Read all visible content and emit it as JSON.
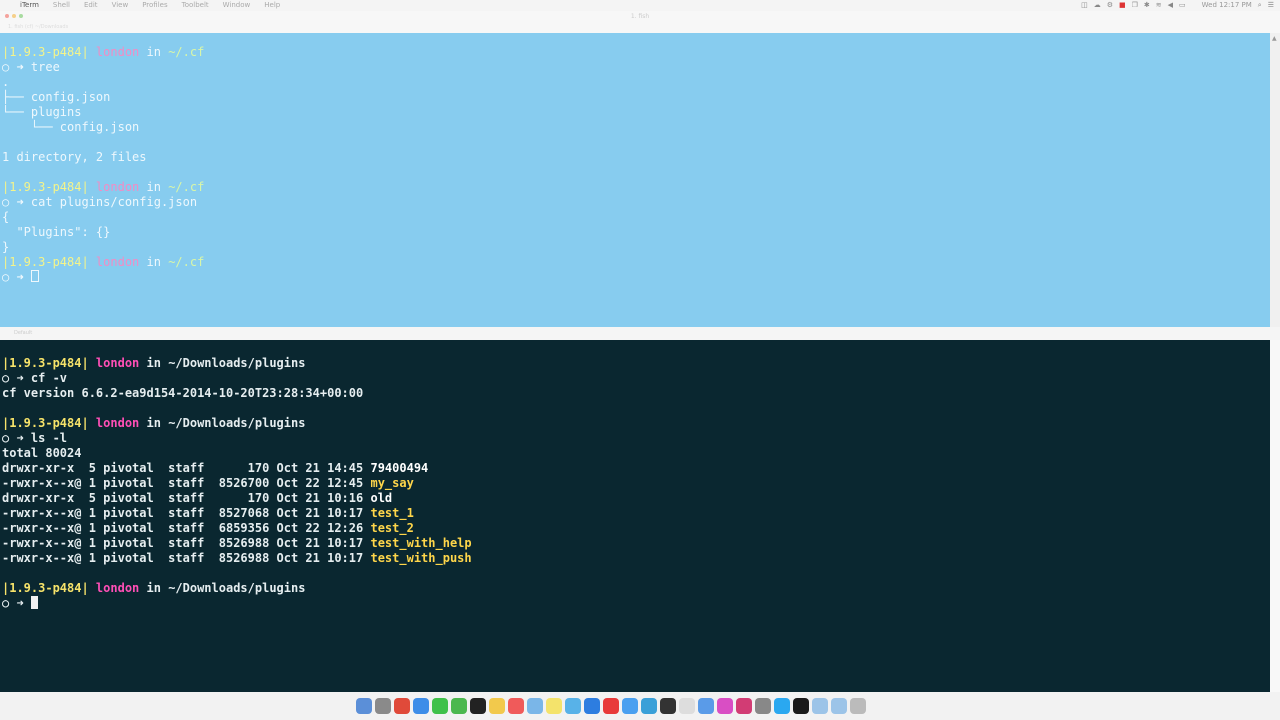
{
  "menubar": {
    "app_name": "iTerm",
    "items": [
      "Shell",
      "Edit",
      "View",
      "Profiles",
      "Toolbelt",
      "Window",
      "Help"
    ],
    "clock": "Wed 12:17 PM"
  },
  "window": {
    "title": "1. fish",
    "tab_label": "1. fish (cf)  ~/Downloads"
  },
  "split_label": "Default",
  "top_pane": {
    "lines": [
      [
        {
          "t": "|1.9.3-p484| ",
          "c": "c-yel"
        },
        {
          "t": "london",
          "c": "c-pink"
        },
        {
          "t": " in ",
          "c": "c-dim"
        },
        {
          "t": "~/.cf",
          "c": "c-green"
        }
      ],
      [
        {
          "t": "○ ➜ tree",
          "c": "c-dim"
        }
      ],
      [
        {
          "t": ".",
          "c": "c-dim"
        }
      ],
      [
        {
          "t": "├── config.json",
          "c": "c-dim"
        }
      ],
      [
        {
          "t": "└── plugins",
          "c": "c-dim"
        }
      ],
      [
        {
          "t": "    └── config.json",
          "c": "c-dim"
        }
      ],
      [
        {
          "t": "",
          "c": "c-dim"
        }
      ],
      [
        {
          "t": "1 directory, 2 files",
          "c": "c-dim"
        }
      ],
      [
        {
          "t": "",
          "c": "c-dim"
        }
      ],
      [
        {
          "t": "|1.9.3-p484| ",
          "c": "c-yel"
        },
        {
          "t": "london",
          "c": "c-pink"
        },
        {
          "t": " in ",
          "c": "c-dim"
        },
        {
          "t": "~/.cf",
          "c": "c-green"
        }
      ],
      [
        {
          "t": "○ ➜ cat plugins/config.json",
          "c": "c-dim"
        }
      ],
      [
        {
          "t": "{",
          "c": "c-dim"
        }
      ],
      [
        {
          "t": "  \"Plugins\": {}",
          "c": "c-dim"
        }
      ],
      [
        {
          "t": "}",
          "c": "c-dim"
        }
      ],
      [
        {
          "t": "|1.9.3-p484| ",
          "c": "c-yel"
        },
        {
          "t": "london",
          "c": "c-pink"
        },
        {
          "t": " in ",
          "c": "c-dim"
        },
        {
          "t": "~/.cf",
          "c": "c-green"
        }
      ],
      [
        {
          "t": "○ ➜ ",
          "c": "c-dim"
        }
      ]
    ]
  },
  "bottom_pane": {
    "lines": [
      [
        {
          "t": "|1.9.3-p484| ",
          "c": "c-yel"
        },
        {
          "t": "london",
          "c": "c-pink"
        },
        {
          "t": " in ",
          "c": "c-text"
        },
        {
          "t": "~/Downloads/plugins",
          "c": "c-text"
        }
      ],
      [
        {
          "t": "○ ➜ cf -v",
          "c": "c-text"
        }
      ],
      [
        {
          "t": "cf version 6.6.2-ea9d154-2014-10-20T23:28:34+00:00",
          "c": "c-text"
        }
      ],
      [
        {
          "t": "",
          "c": "c-text"
        }
      ],
      [
        {
          "t": "|1.9.3-p484| ",
          "c": "c-yel"
        },
        {
          "t": "london",
          "c": "c-pink"
        },
        {
          "t": " in ",
          "c": "c-text"
        },
        {
          "t": "~/Downloads/plugins",
          "c": "c-text"
        }
      ],
      [
        {
          "t": "○ ➜ ls -l",
          "c": "c-text"
        }
      ],
      [
        {
          "t": "total 80024",
          "c": "c-text"
        }
      ],
      [
        {
          "t": "drwxr-xr-x  5 pivotal  staff      170 Oct 21 14:45 ",
          "c": "c-text"
        },
        {
          "t": "79400494",
          "c": "c-dir"
        }
      ],
      [
        {
          "t": "-rwxr-x--x@ 1 pivotal  staff  8526700 Oct 22 12:45 ",
          "c": "c-text"
        },
        {
          "t": "my_say",
          "c": "c-file"
        }
      ],
      [
        {
          "t": "drwxr-xr-x  5 pivotal  staff      170 Oct 21 10:16 ",
          "c": "c-text"
        },
        {
          "t": "old",
          "c": "c-dir"
        }
      ],
      [
        {
          "t": "-rwxr-x--x@ 1 pivotal  staff  8527068 Oct 21 10:17 ",
          "c": "c-text"
        },
        {
          "t": "test_1",
          "c": "c-file"
        }
      ],
      [
        {
          "t": "-rwxr-x--x@ 1 pivotal  staff  6859356 Oct 22 12:26 ",
          "c": "c-text"
        },
        {
          "t": "test_2",
          "c": "c-file"
        }
      ],
      [
        {
          "t": "-rwxr-x--x@ 1 pivotal  staff  8526988 Oct 21 10:17 ",
          "c": "c-text"
        },
        {
          "t": "test_with_help",
          "c": "c-file"
        }
      ],
      [
        {
          "t": "-rwxr-x--x@ 1 pivotal  staff  8526988 Oct 21 10:17 ",
          "c": "c-text"
        },
        {
          "t": "test_with_push",
          "c": "c-file"
        }
      ],
      [
        {
          "t": "",
          "c": "c-text"
        }
      ],
      [
        {
          "t": "|1.9.3-p484| ",
          "c": "c-yel"
        },
        {
          "t": "london",
          "c": "c-pink"
        },
        {
          "t": " in ",
          "c": "c-text"
        },
        {
          "t": "~/Downloads/plugins",
          "c": "c-text"
        }
      ],
      [
        {
          "t": "○ ➜ ",
          "c": "c-text"
        }
      ]
    ]
  },
  "dock": {
    "icons": [
      {
        "name": "finder-icon",
        "color": "#5b8fd8"
      },
      {
        "name": "launchpad-icon",
        "color": "#8a8a8a"
      },
      {
        "name": "chrome-icon",
        "color": "#e04a3a"
      },
      {
        "name": "safari-icon",
        "color": "#3d8de8"
      },
      {
        "name": "messages-icon",
        "color": "#3fc14a"
      },
      {
        "name": "facetime-icon",
        "color": "#4bb84f"
      },
      {
        "name": "terminal-icon",
        "color": "#222222"
      },
      {
        "name": "notes-icon",
        "color": "#f2c94c"
      },
      {
        "name": "calendar-icon",
        "color": "#f05a5a"
      },
      {
        "name": "preview-icon",
        "color": "#7ab6e8"
      },
      {
        "name": "stickies-icon",
        "color": "#f4e36b"
      },
      {
        "name": "maps-icon",
        "color": "#58b2e8"
      },
      {
        "name": "app-store-icon",
        "color": "#2d7de0"
      },
      {
        "name": "reminders-icon",
        "color": "#e83a3a"
      },
      {
        "name": "mail-icon",
        "color": "#4aa0f0"
      },
      {
        "name": "iphoto-icon",
        "color": "#3aa0d8"
      },
      {
        "name": "activity-monitor-icon",
        "color": "#333333"
      },
      {
        "name": "textedit-icon",
        "color": "#dddddd"
      },
      {
        "name": "keynote-icon",
        "color": "#5a9be8"
      },
      {
        "name": "itunes-icon",
        "color": "#d94ec4"
      },
      {
        "name": "photo-booth-icon",
        "color": "#d23c74"
      },
      {
        "name": "system-preferences-icon",
        "color": "#888888"
      },
      {
        "name": "skype-icon",
        "color": "#2aa8f0"
      },
      {
        "name": "iterm-icon",
        "color": "#1a1a1a"
      },
      {
        "name": "downloads-folder-icon",
        "color": "#9cc4e8"
      },
      {
        "name": "documents-folder-icon",
        "color": "#9cc4e8"
      },
      {
        "name": "trash-icon",
        "color": "#bbbbbb"
      }
    ]
  }
}
